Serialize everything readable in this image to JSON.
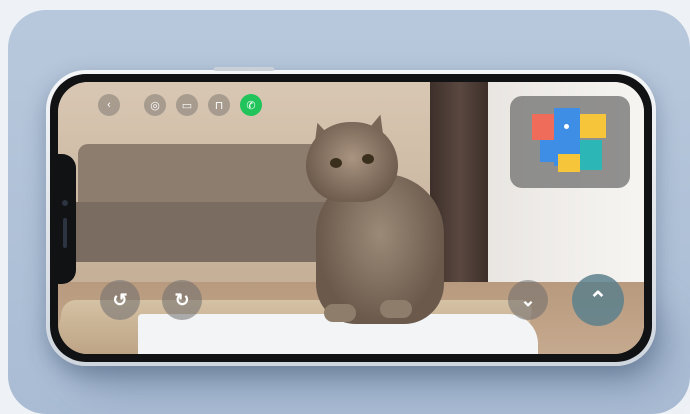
{
  "colors": {
    "card_bg": "#aebfd6",
    "call_green": "#21c45a",
    "tile_red": "#ef6b5a",
    "tile_blue": "#3f8ee6",
    "tile_yellow": "#f7c53a",
    "tile_teal": "#2cb7b6"
  },
  "controls": {
    "top": [
      {
        "name": "back-icon",
        "glyph": "‹"
      },
      {
        "name": "settings-icon",
        "glyph": "◎"
      },
      {
        "name": "record-video-icon",
        "glyph": "▭"
      },
      {
        "name": "robot-icon",
        "glyph": "⊓"
      },
      {
        "name": "call-icon",
        "glyph": "✆"
      }
    ],
    "rotate_left_glyph": "↺",
    "rotate_right_glyph": "↻",
    "down_glyph": "⌄",
    "up_glyph": "⌃"
  },
  "minimap": {
    "icon": "room-map-icon"
  },
  "scene": {
    "subject": "cat-video-feed"
  }
}
